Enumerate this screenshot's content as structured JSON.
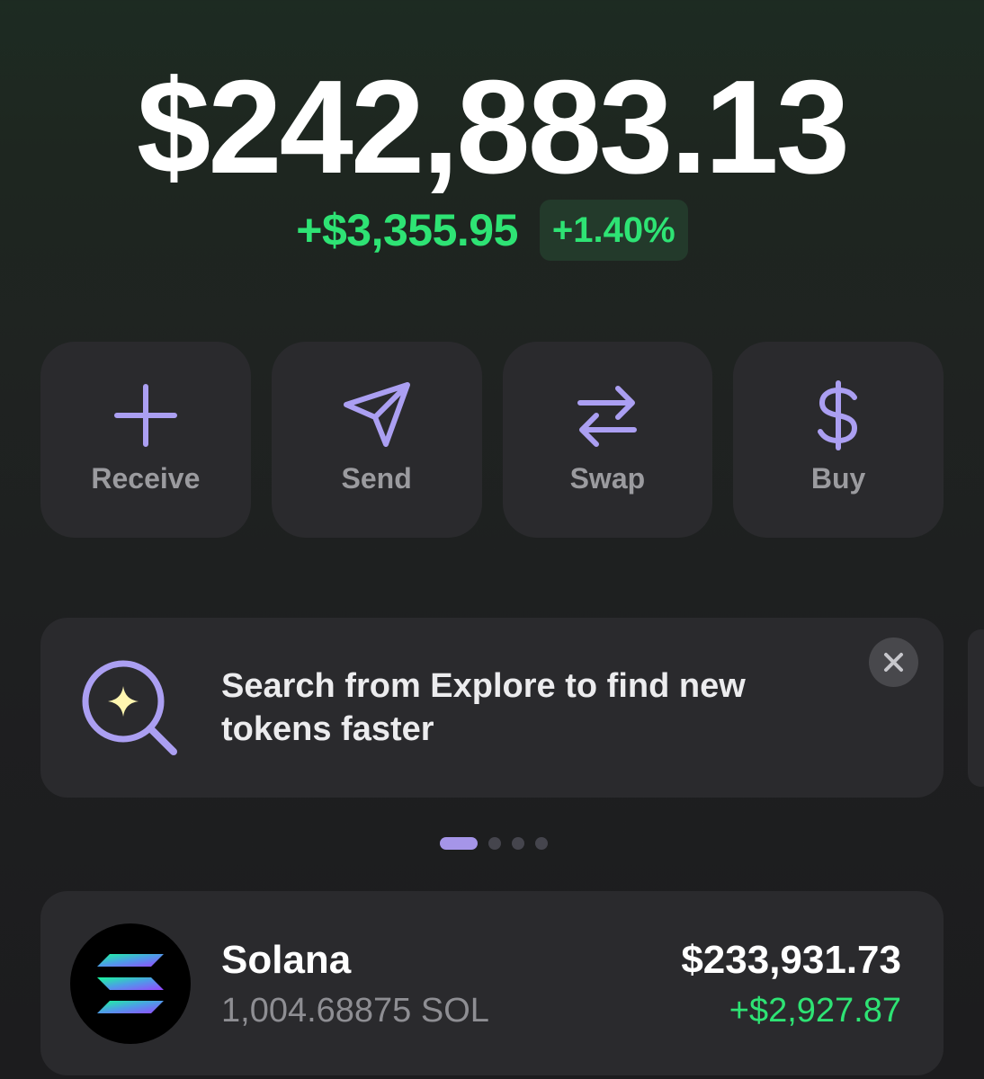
{
  "portfolio": {
    "balance": "$242,883.13",
    "change_amount": "+$3,355.95",
    "change_percent": "+1.40%"
  },
  "actions": [
    {
      "label": "Receive",
      "icon": "plus-icon"
    },
    {
      "label": "Send",
      "icon": "send-icon"
    },
    {
      "label": "Swap",
      "icon": "swap-icon"
    },
    {
      "label": "Buy",
      "icon": "dollar-icon"
    }
  ],
  "banner": {
    "text": "Search from Explore to find new tokens faster",
    "icon": "search-sparkle-icon",
    "close_icon": "close-icon"
  },
  "pagination": {
    "total": 4,
    "active_index": 0
  },
  "tokens": [
    {
      "name": "Solana",
      "amount": "1,004.68875 SOL",
      "value": "$233,931.73",
      "change": "+$2,927.87",
      "icon": "solana-logo-icon"
    }
  ],
  "colors": {
    "accent": "#ab9ff2",
    "positive": "#2ee374",
    "card": "#2a2a2d",
    "muted_text": "#8e8e93"
  }
}
